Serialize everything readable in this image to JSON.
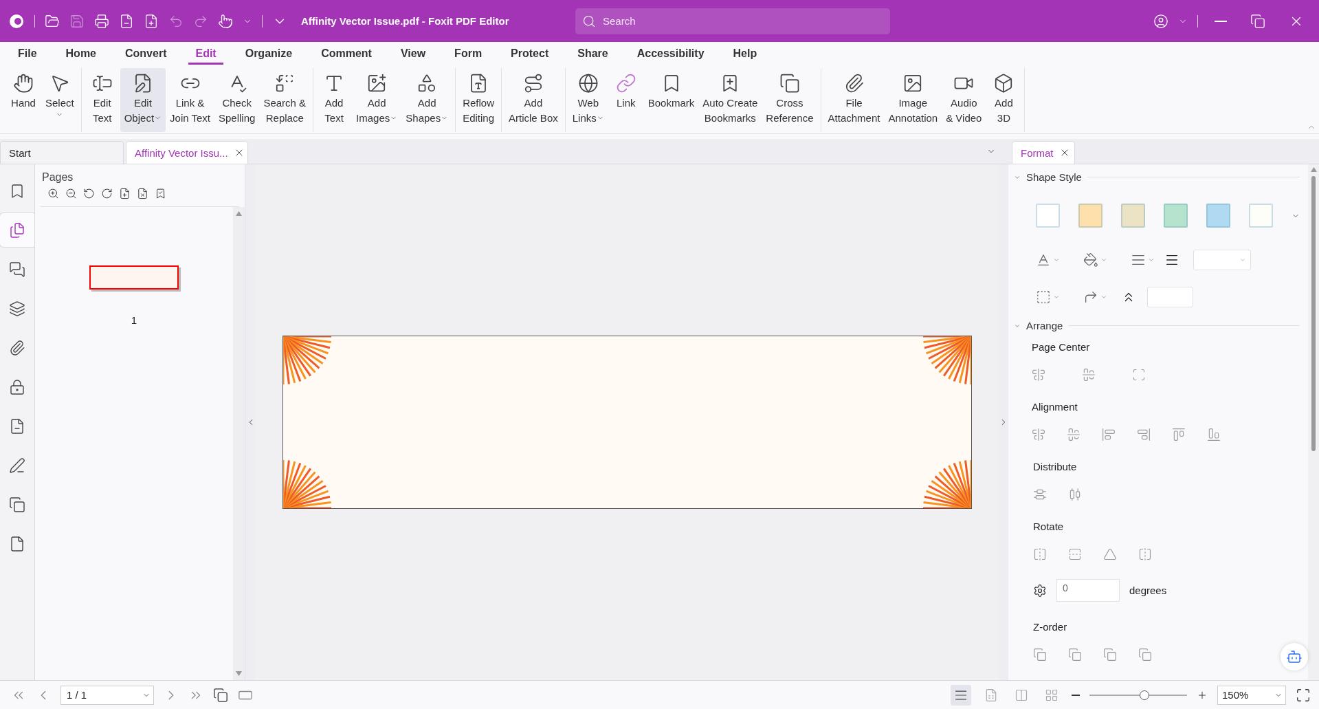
{
  "title_bar": {
    "title": "Affinity Vector Issue.pdf - Foxit PDF Editor",
    "search": {
      "placeholder": "Search"
    }
  },
  "menu": [
    {
      "label": "File",
      "selected": false
    },
    {
      "label": "Home",
      "selected": false
    },
    {
      "label": "Convert",
      "selected": false
    },
    {
      "label": "Edit",
      "selected": true
    },
    {
      "label": "Organize",
      "selected": false
    },
    {
      "label": "Comment",
      "selected": false
    },
    {
      "label": "View",
      "selected": false
    },
    {
      "label": "Form",
      "selected": false
    },
    {
      "label": "Protect",
      "selected": false
    },
    {
      "label": "Share",
      "selected": false
    },
    {
      "label": "Accessibility",
      "selected": false
    },
    {
      "label": "Help",
      "selected": false
    }
  ],
  "ribbon_groups": [
    {
      "items": [
        {
          "lines": [
            "Hand"
          ],
          "dropdown": false,
          "selected": false
        },
        {
          "lines": [
            "Select"
          ],
          "dropdown": true,
          "selected": false
        }
      ]
    },
    {
      "items": [
        {
          "lines": [
            "Edit",
            "Text"
          ],
          "dropdown": false,
          "selected": false
        },
        {
          "lines": [
            "Edit",
            "Object"
          ],
          "dropdown": true,
          "selected": true
        },
        {
          "lines": [
            "Link &",
            "Join Text"
          ],
          "dropdown": false,
          "selected": false
        },
        {
          "lines": [
            "Check",
            "Spelling"
          ],
          "dropdown": false,
          "selected": false
        },
        {
          "lines": [
            "Search &",
            "Replace"
          ],
          "dropdown": false,
          "selected": false
        }
      ]
    },
    {
      "items": [
        {
          "lines": [
            "Add",
            "Text"
          ],
          "dropdown": false,
          "selected": false
        },
        {
          "lines": [
            "Add",
            "Images"
          ],
          "dropdown": true,
          "selected": false
        },
        {
          "lines": [
            "Add",
            "Shapes"
          ],
          "dropdown": true,
          "selected": false
        }
      ]
    },
    {
      "items": [
        {
          "lines": [
            "Reflow",
            "Editing"
          ],
          "dropdown": false,
          "selected": false
        }
      ]
    },
    {
      "items": [
        {
          "lines": [
            "Add",
            "Article Box"
          ],
          "dropdown": false,
          "selected": false
        }
      ]
    },
    {
      "items": [
        {
          "lines": [
            "Web",
            "Links"
          ],
          "dropdown": true,
          "selected": false
        },
        {
          "lines": [
            "Link"
          ],
          "dropdown": false,
          "selected": false
        },
        {
          "lines": [
            "Bookmark"
          ],
          "dropdown": false,
          "selected": false
        },
        {
          "lines": [
            "Auto Create",
            "Bookmarks"
          ],
          "dropdown": false,
          "selected": false
        },
        {
          "lines": [
            "Cross",
            "Reference"
          ],
          "dropdown": false,
          "selected": false
        }
      ]
    },
    {
      "items": [
        {
          "lines": [
            "File",
            "Attachment"
          ],
          "dropdown": false,
          "selected": false
        },
        {
          "lines": [
            "Image",
            "Annotation"
          ],
          "dropdown": false,
          "selected": false
        },
        {
          "lines": [
            "Audio",
            "& Video"
          ],
          "dropdown": false,
          "selected": false
        },
        {
          "lines": [
            "Add",
            "3D"
          ],
          "dropdown": false,
          "selected": false
        }
      ]
    }
  ],
  "doc_tabs": [
    {
      "label": "Start",
      "selected": false,
      "closable": false
    },
    {
      "label": "Affinity Vector Issu...",
      "selected": true,
      "closable": true
    }
  ],
  "left_rail": [
    {
      "selected": false
    },
    {
      "selected": true
    },
    {
      "selected": false
    },
    {
      "selected": false
    },
    {
      "selected": false
    },
    {
      "selected": false
    },
    {
      "selected": false
    },
    {
      "selected": false
    },
    {
      "selected": false
    },
    {
      "selected": false
    }
  ],
  "pages_panel": {
    "title": "Pages",
    "thumbnails": [
      {
        "label": "1",
        "selected": true
      }
    ]
  },
  "format_tab": {
    "label": "Format"
  },
  "format_panel": {
    "shape_style": {
      "title": "Shape Style",
      "swatches": [
        {
          "color": "#ffffff"
        },
        {
          "color": "#fde0ac"
        },
        {
          "color": "#ece3c4"
        },
        {
          "color": "#b6e3cd"
        },
        {
          "color": "#afdaf1"
        },
        {
          "color": "#fdfef8"
        }
      ]
    },
    "arrange": {
      "title": "Arrange",
      "sections": [
        {
          "title": "Page Center",
          "kind": "icons"
        },
        {
          "title": "Alignment",
          "kind": "icons"
        },
        {
          "title": "Distribute",
          "kind": "icons"
        },
        {
          "title": "Rotate",
          "kind": "rotate"
        },
        {
          "title": "Z-order",
          "kind": "icons"
        }
      ]
    },
    "rotation": {
      "value": "0",
      "unit": "degrees"
    }
  },
  "status_bar": {
    "page": "1 / 1",
    "view_modes": [
      {
        "selected": true
      },
      {
        "selected": false
      },
      {
        "selected": false
      },
      {
        "selected": false
      }
    ],
    "zoom": {
      "level": 0.56,
      "value": "150%"
    }
  }
}
